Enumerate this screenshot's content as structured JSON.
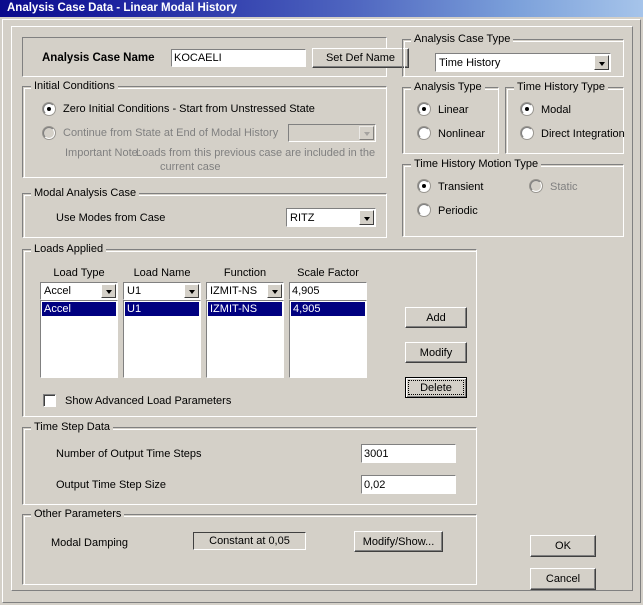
{
  "window": {
    "title": "Analysis Case Data - Linear Modal History"
  },
  "case_name": {
    "label": "Analysis Case Name",
    "value": "KOCAELI",
    "set_def_name_button": "Set Def Name"
  },
  "analysis_case_type": {
    "legend": "Analysis Case Type",
    "selected": "Time History"
  },
  "initial_conditions": {
    "legend": "Initial Conditions",
    "option_zero": "Zero Initial Conditions - Start from Unstressed State",
    "option_continue": "Continue from State at End of Modal History",
    "continue_combo_value": "",
    "note_label": "Important Note:",
    "note_line1": "Loads from this previous case are included in the",
    "note_line2": "current case"
  },
  "analysis_type": {
    "legend": "Analysis Type",
    "option_linear": "Linear",
    "option_nonlinear": "Nonlinear"
  },
  "time_history_type": {
    "legend": "Time History Type",
    "option_modal": "Modal",
    "option_direct": "Direct Integration"
  },
  "time_history_motion_type": {
    "legend": "Time History Motion Type",
    "option_transient": "Transient",
    "option_periodic": "Periodic",
    "option_static": "Static"
  },
  "modal_analysis_case": {
    "legend": "Modal Analysis Case",
    "label": "Use Modes from Case",
    "selected": "RITZ"
  },
  "loads_applied": {
    "legend": "Loads Applied",
    "headers": {
      "load_type": "Load Type",
      "load_name": "Load Name",
      "function": "Function",
      "scale_factor": "Scale Factor"
    },
    "editor": {
      "load_type": "Accel",
      "load_name": "U1",
      "function": "IZMIT-NS",
      "scale_factor": "4,905"
    },
    "rows": [
      {
        "load_type": "Accel",
        "load_name": "U1",
        "function": "IZMIT-NS",
        "scale_factor": "4,905"
      }
    ],
    "add_button": "Add",
    "modify_button": "Modify",
    "delete_button": "Delete",
    "show_advanced_label": "Show Advanced Load Parameters"
  },
  "time_step_data": {
    "legend": "Time Step Data",
    "num_steps_label": "Number of Output Time Steps",
    "num_steps_value": "3001",
    "step_size_label": "Output Time Step Size",
    "step_size_value": "0,02"
  },
  "other_parameters": {
    "legend": "Other Parameters",
    "modal_damping_label": "Modal Damping",
    "modal_damping_value": "Constant at 0,05",
    "modify_show_button": "Modify/Show..."
  },
  "actions": {
    "ok_button": "OK",
    "cancel_button": "Cancel"
  },
  "colors": {
    "face": "#d4d0c8",
    "selection": "#000080",
    "title_start": "#0a0a8c",
    "title_end": "#a6c4ea",
    "disabled_text": "#808080"
  }
}
